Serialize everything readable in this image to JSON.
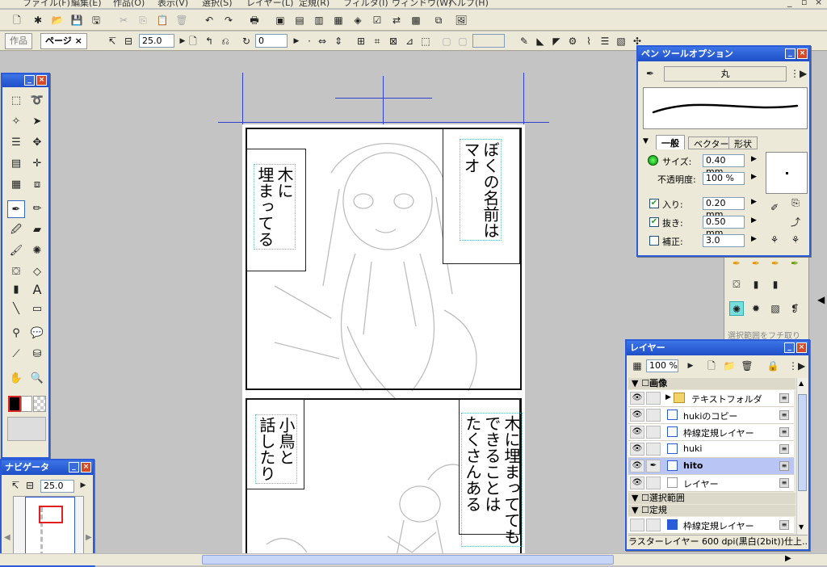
{
  "menu": [
    "ファイル(F)",
    "編集(E)",
    "作品(O)",
    "表示(V)",
    "選択(S)",
    "レイヤー(L)",
    "定規(R)",
    "フィルタ(I)",
    "ウィンドウ(W)",
    "ヘルプ(H)"
  ],
  "toolbar2": {
    "tab_work": "作品",
    "tab_page": "ページ",
    "tab_close": "×",
    "zoom_value": "25.0",
    "rotate_value": "0"
  },
  "pages": {
    "top_left_text": "木に\n埋まってる",
    "top_right_text": "ぼくの名前は\nマオ",
    "bottom_left_text": "小鳥と\n話したり",
    "bottom_right_text": "木に埋まってても\nできることは\nたくさんある"
  },
  "navigator": {
    "title": "ナビゲータ",
    "zoom_value": "25.0"
  },
  "pen_options": {
    "title": "ペン ツールオプション",
    "brush_name": "丸",
    "tabs": [
      "一般",
      "ベクター",
      "形状"
    ],
    "size_label": "サイズ:",
    "size_value": "0.40 mm",
    "opacity_label": "不透明度:",
    "opacity_value": "100 %",
    "in_label": "入り:",
    "in_value": "0.20 mm",
    "out_label": "抜き:",
    "out_value": "0.50 mm",
    "correct_label": "補正:",
    "correct_value": "3.0",
    "in_checked": true,
    "out_checked": true,
    "correct_checked": false
  },
  "tool_palette_partial": {
    "hint_text": "選択範囲をフチ取り"
  },
  "layers": {
    "title": "レイヤー",
    "opacity": "100 %",
    "group_image": "画像",
    "rows": [
      "テキストフォルダ",
      "hukiのコピー",
      "枠線定規レイヤー",
      "huki",
      "hito",
      "レイヤー"
    ],
    "active_row": "hito",
    "section_selection": "選択範囲",
    "section_ruler": "定規",
    "ruler_row": "枠線定規レイヤー",
    "status": "ラスターレイヤー 600 dpi(黒白(2bit))仕上..."
  },
  "colors": {
    "title_blue": "#1f4fc8",
    "active_layer": "#b9c6f5",
    "guide": "#3040d0"
  }
}
